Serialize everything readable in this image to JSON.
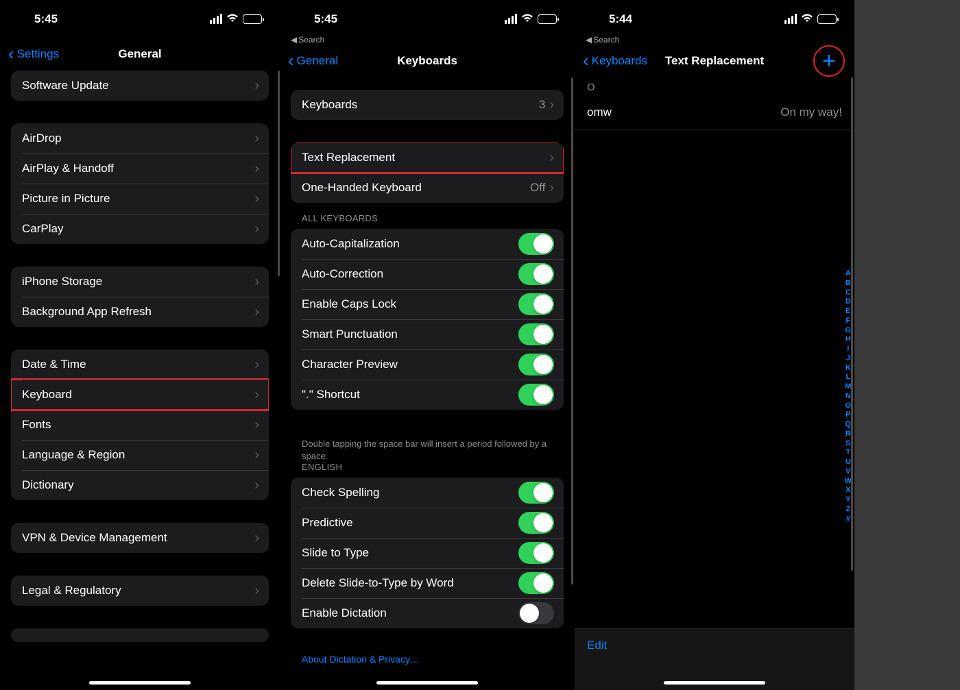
{
  "screen1": {
    "time": "5:45",
    "back": "Settings",
    "title": "General",
    "groups": [
      {
        "rows": [
          {
            "label": "Software Update"
          }
        ]
      },
      {
        "rows": [
          {
            "label": "AirDrop"
          },
          {
            "label": "AirPlay & Handoff"
          },
          {
            "label": "Picture in Picture"
          },
          {
            "label": "CarPlay"
          }
        ]
      },
      {
        "rows": [
          {
            "label": "iPhone Storage"
          },
          {
            "label": "Background App Refresh"
          }
        ]
      },
      {
        "rows": [
          {
            "label": "Date & Time"
          },
          {
            "label": "Keyboard",
            "highlight": true
          },
          {
            "label": "Fonts"
          },
          {
            "label": "Language & Region"
          },
          {
            "label": "Dictionary"
          }
        ]
      },
      {
        "rows": [
          {
            "label": "VPN & Device Management"
          }
        ]
      },
      {
        "rows": [
          {
            "label": "Legal & Regulatory"
          }
        ]
      }
    ]
  },
  "screen2": {
    "time": "5:45",
    "back_search": "Search",
    "back": "General",
    "title": "Keyboards",
    "group_top": {
      "label": "Keyboards",
      "value": "3"
    },
    "group_mid": [
      {
        "label": "Text Replacement",
        "highlight": true
      },
      {
        "label": "One-Handed Keyboard",
        "value": "Off"
      }
    ],
    "header_all": "ALL KEYBOARDS",
    "toggles_all": [
      {
        "label": "Auto-Capitalization",
        "on": true
      },
      {
        "label": "Auto-Correction",
        "on": true
      },
      {
        "label": "Enable Caps Lock",
        "on": true
      },
      {
        "label": "Smart Punctuation",
        "on": true
      },
      {
        "label": "Character Preview",
        "on": true
      },
      {
        "label": "\".\" Shortcut",
        "on": true
      }
    ],
    "footnote": "Double tapping the space bar will insert a period followed by a space.",
    "header_eng": "ENGLISH",
    "toggles_eng": [
      {
        "label": "Check Spelling",
        "on": true
      },
      {
        "label": "Predictive",
        "on": true
      },
      {
        "label": "Slide to Type",
        "on": true
      },
      {
        "label": "Delete Slide-to-Type by Word",
        "on": true
      },
      {
        "label": "Enable Dictation",
        "on": false
      }
    ],
    "dictation_link": "About Dictation & Privacy…"
  },
  "screen3": {
    "time": "5:44",
    "back_search": "Search",
    "back": "Keyboards",
    "title": "Text Replacement",
    "section": "O",
    "entries": [
      {
        "shortcut": "omw",
        "phrase": "On my way!"
      }
    ],
    "alpha": [
      "A",
      "B",
      "C",
      "D",
      "E",
      "F",
      "G",
      "H",
      "I",
      "J",
      "K",
      "L",
      "M",
      "N",
      "O",
      "P",
      "Q",
      "R",
      "S",
      "T",
      "U",
      "V",
      "W",
      "X",
      "Y",
      "Z",
      "#"
    ],
    "edit": "Edit"
  }
}
